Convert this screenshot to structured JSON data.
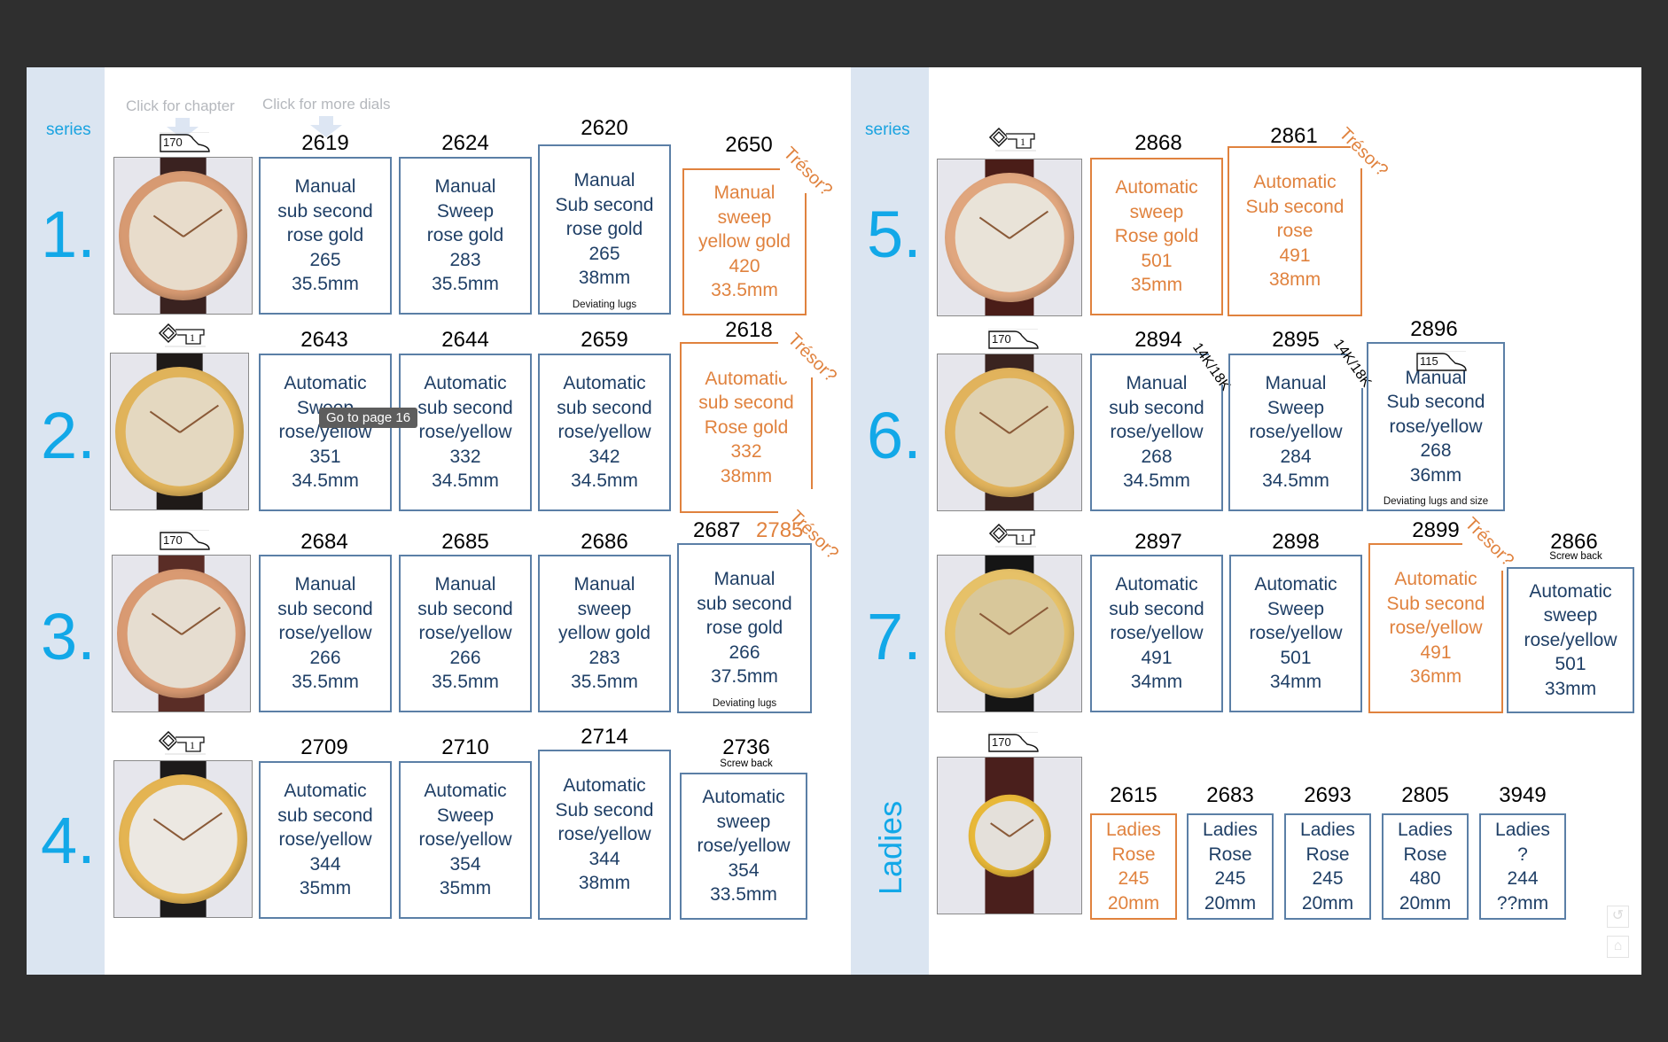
{
  "colors": {
    "accent_blue": "#12a8e8",
    "box_border": "#5b7fa6",
    "box_text": "#1f3f66",
    "tresor_orange": "#e0823e",
    "sidebar": "#dbe5f1"
  },
  "left_page": {
    "series_label": "series",
    "hints": {
      "chapter": "Click for chapter",
      "dials": "Click for more dials"
    },
    "rows": [
      {
        "num": "1.",
        "stamp": "170",
        "items": [
          {
            "ref": "2619",
            "lines": [
              "Manual",
              "sub second",
              "rose gold",
              "265",
              "35.5mm"
            ]
          },
          {
            "ref": "2624",
            "lines": [
              "Manual",
              "Sweep",
              "rose gold",
              "283",
              "35.5mm"
            ]
          },
          {
            "ref": "2620",
            "lines": [
              "Manual",
              "Sub second",
              "rose gold",
              "265",
              "38mm"
            ],
            "note": "Deviating lugs"
          },
          {
            "ref": "2650",
            "lines": [
              "Manual",
              "sweep",
              "yellow gold",
              "420",
              "33.5mm"
            ],
            "tresor": "Trésor?"
          }
        ]
      },
      {
        "num": "2.",
        "stamp": "1",
        "items": [
          {
            "ref": "2643",
            "lines": [
              "Automatic",
              "Sweep",
              "rose/yellow",
              "351",
              "34.5mm"
            ]
          },
          {
            "ref": "2644",
            "lines": [
              "Automatic",
              "sub second",
              "rose/yellow",
              "332",
              "34.5mm"
            ]
          },
          {
            "ref": "2659",
            "lines": [
              "Automatic",
              "sub second",
              "rose/yellow",
              "342",
              "34.5mm"
            ]
          },
          {
            "ref": "2618",
            "lines": [
              "Automatic",
              "sub second",
              "Rose gold",
              "332",
              "38mm"
            ],
            "tresor": "Trésor?"
          }
        ]
      },
      {
        "num": "3.",
        "stamp": "170",
        "items": [
          {
            "ref": "2684",
            "lines": [
              "Manual",
              "sub second",
              "rose/yellow",
              "266",
              "35.5mm"
            ]
          },
          {
            "ref": "2685",
            "lines": [
              "Manual",
              "sub second",
              "rose/yellow",
              "266",
              "35.5mm"
            ]
          },
          {
            "ref": "2686",
            "lines": [
              "Manual",
              "sweep",
              "yellow gold",
              "283",
              "35.5mm"
            ]
          },
          {
            "ref": "2687",
            "ref2": "2785",
            "lines": [
              "Manual",
              "sub second",
              "rose gold",
              "266",
              "37.5mm"
            ],
            "note": "Deviating lugs",
            "tresor": "Trésor?"
          }
        ]
      },
      {
        "num": "4.",
        "stamp": "1",
        "items": [
          {
            "ref": "2709",
            "lines": [
              "Automatic",
              "sub second",
              "rose/yellow",
              "344",
              "35mm"
            ]
          },
          {
            "ref": "2710",
            "lines": [
              "Automatic",
              "Sweep",
              "rose/yellow",
              "354",
              "35mm"
            ]
          },
          {
            "ref": "2714",
            "lines": [
              "Automatic",
              "Sub second",
              "rose/yellow",
              "344",
              "38mm"
            ]
          },
          {
            "ref": "2736",
            "subref": "Screw back",
            "lines": [
              "Automatic",
              "sweep",
              "rose/yellow",
              "354",
              "33.5mm"
            ]
          }
        ]
      }
    ],
    "tooltip": "Go to page 16"
  },
  "right_page": {
    "series_label": "series",
    "rows": [
      {
        "num": "5.",
        "stamp": "1",
        "items": [
          {
            "ref": "2868",
            "lines": [
              "Automatic",
              "sweep",
              "Rose gold",
              "501",
              "35mm"
            ]
          },
          {
            "ref": "2861",
            "lines": [
              "Automatic",
              "Sub second",
              "rose",
              "491",
              "38mm"
            ],
            "tresor": "Trésor?"
          }
        ]
      },
      {
        "num": "6.",
        "stamp": "170",
        "items": [
          {
            "ref": "2894",
            "karat": "14K/18K",
            "lines": [
              "Manual",
              "sub second",
              "rose/yellow",
              "268",
              "34.5mm"
            ]
          },
          {
            "ref": "2895",
            "karat": "14K/18K",
            "lines": [
              "Manual",
              "Sweep",
              "rose/yellow",
              "284",
              "34.5mm"
            ]
          },
          {
            "ref": "2896",
            "inner_stamp": "115",
            "lines": [
              "Manual",
              "Sub second",
              "rose/yellow",
              "268",
              "36mm"
            ],
            "note": "Deviating lugs and size"
          }
        ]
      },
      {
        "num": "7.",
        "stamp": "1",
        "items": [
          {
            "ref": "2897",
            "lines": [
              "Automatic",
              "sub second",
              "rose/yellow",
              "491",
              "34mm"
            ]
          },
          {
            "ref": "2898",
            "lines": [
              "Automatic",
              "Sweep",
              "rose/yellow",
              "501",
              "34mm"
            ]
          },
          {
            "ref": "2899",
            "lines": [
              "Automatic",
              "Sub second",
              "rose/yellow",
              "491",
              "36mm"
            ],
            "tresor": "Trésor?"
          },
          {
            "ref": "2866",
            "subref": "Screw back",
            "lines": [
              "Automatic",
              "sweep",
              "rose/yellow",
              "501",
              "33mm"
            ]
          }
        ]
      },
      {
        "num": "Ladies",
        "stamp": "170",
        "items": [
          {
            "ref": "2615",
            "lines": [
              "Ladies",
              "Rose",
              "245",
              "20mm"
            ]
          },
          {
            "ref": "2683",
            "lines": [
              "Ladies",
              "Rose",
              "245",
              "20mm"
            ]
          },
          {
            "ref": "2693",
            "lines": [
              "Ladies",
              "Rose",
              "245",
              "20mm"
            ]
          },
          {
            "ref": "2805",
            "lines": [
              "Ladies",
              "Rose",
              "480",
              "20mm"
            ]
          },
          {
            "ref": "3949",
            "lines": [
              "Ladies",
              "?",
              "244",
              "??mm"
            ]
          }
        ]
      }
    ],
    "nav": {
      "back_icon": "↺",
      "home_icon": "⌂"
    }
  }
}
